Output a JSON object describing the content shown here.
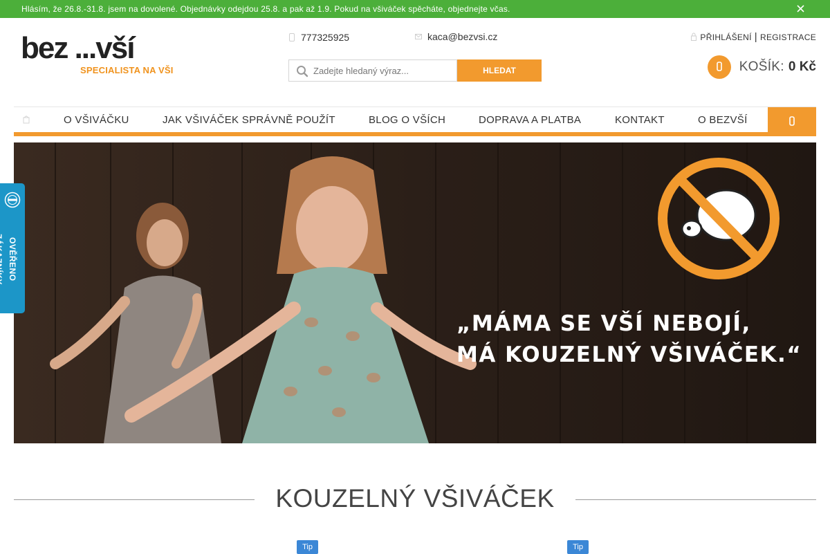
{
  "announcement": {
    "text": "Hlásím, že 26.8.-31.8. jsem na dovolené. Objednávky odejdou 25.8. a pak až 1.9. Pokud na všiváček spěcháte, objednejte včas."
  },
  "brand": {
    "logo_text": "bez ...vší",
    "tagline": "SPECIALISTA NA VŠI"
  },
  "contact": {
    "phone": "777325925",
    "email": "kaca@bezvsi.cz"
  },
  "search": {
    "placeholder": "Zadejte hledaný výraz...",
    "button_label": "HLEDAT"
  },
  "account": {
    "login_label": "PŘIHLÁŠENÍ",
    "separator": "|",
    "register_label": "REGISTRACE"
  },
  "cart": {
    "label": "KOŠÍK:",
    "total": "0 Kč"
  },
  "nav": {
    "items": [
      {
        "label": "O VŠIVÁČKU"
      },
      {
        "label": "JAK VŠIVÁČEK SPRÁVNĚ POUŽÍT"
      },
      {
        "label": "BLOG O VŠÍCH"
      },
      {
        "label": "DOPRAVA A PLATBA"
      },
      {
        "label": "KONTAKT"
      },
      {
        "label": "O BEZVŠÍ"
      }
    ]
  },
  "hero": {
    "quote_line1": "„MÁMA SE VŠÍ NEBOJÍ,",
    "quote_line2": "MÁ KOUZELNÝ VŠIVÁČEK.“"
  },
  "badge": {
    "label": "OVĚŘENO ZÁKAZNÍKY"
  },
  "section": {
    "title": "KOUZELNÝ VŠIVÁČEK"
  },
  "product_tags": [
    "Tip",
    "Tip"
  ],
  "colors": {
    "green": "#4caf3a",
    "orange": "#f29a2e",
    "badge_blue": "#1c96c8",
    "tip_blue": "#3b87d6"
  }
}
